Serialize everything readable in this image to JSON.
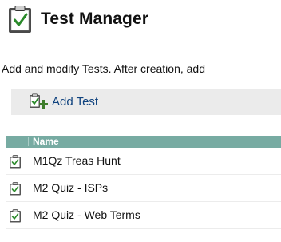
{
  "header": {
    "icon": "clipboard-check-icon",
    "title": "Test Manager"
  },
  "description": "Add and modify Tests. After creation, add",
  "toolbar": {
    "add_icon": "clipboard-add-icon",
    "add_label": "Add Test"
  },
  "table": {
    "columns": [
      "Name"
    ],
    "rows": [
      {
        "icon": "clipboard-check-icon",
        "name": "M1Qz Treas Hunt"
      },
      {
        "icon": "clipboard-check-icon",
        "name": "M2 Quiz - ISPs"
      },
      {
        "icon": "clipboard-check-icon",
        "name": "M2 Quiz - Web Terms"
      }
    ]
  },
  "colors": {
    "table_header_bg": "#77aba2",
    "toolbar_bg": "#ebebeb",
    "link": "#10437f",
    "alt_row_bg": "#efefef"
  }
}
